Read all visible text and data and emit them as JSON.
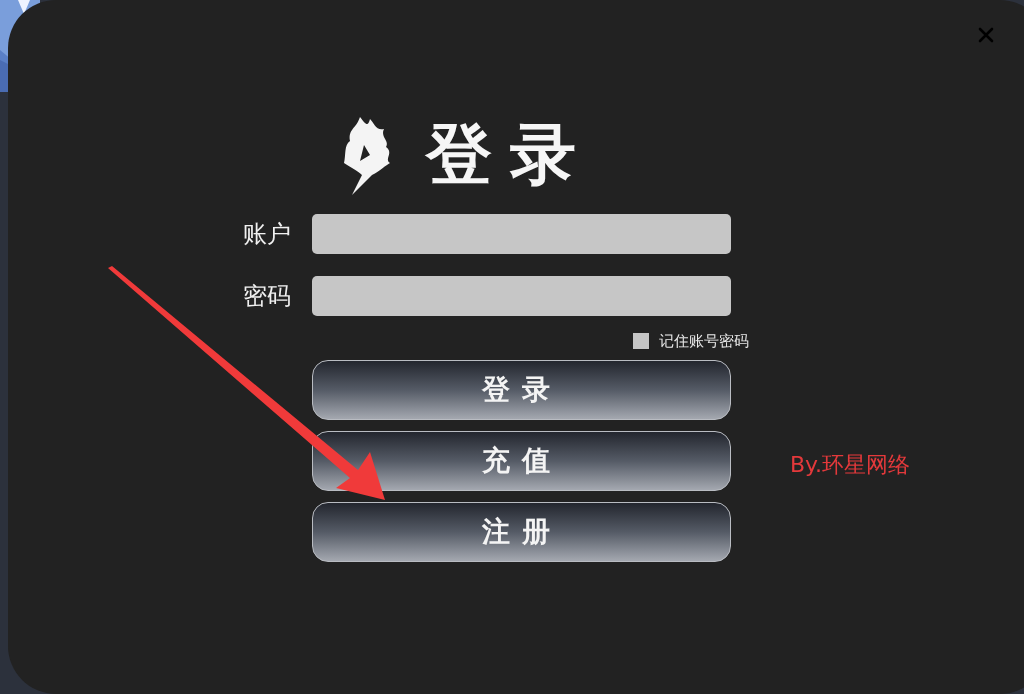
{
  "title": "登录",
  "fields": [
    {
      "label": "账户"
    },
    {
      "label": "密码"
    }
  ],
  "remember": {
    "label": "记住账号密码",
    "checked": false
  },
  "buttons": [
    "登录",
    "充值",
    "注册"
  ],
  "credit": "By.环星网络"
}
